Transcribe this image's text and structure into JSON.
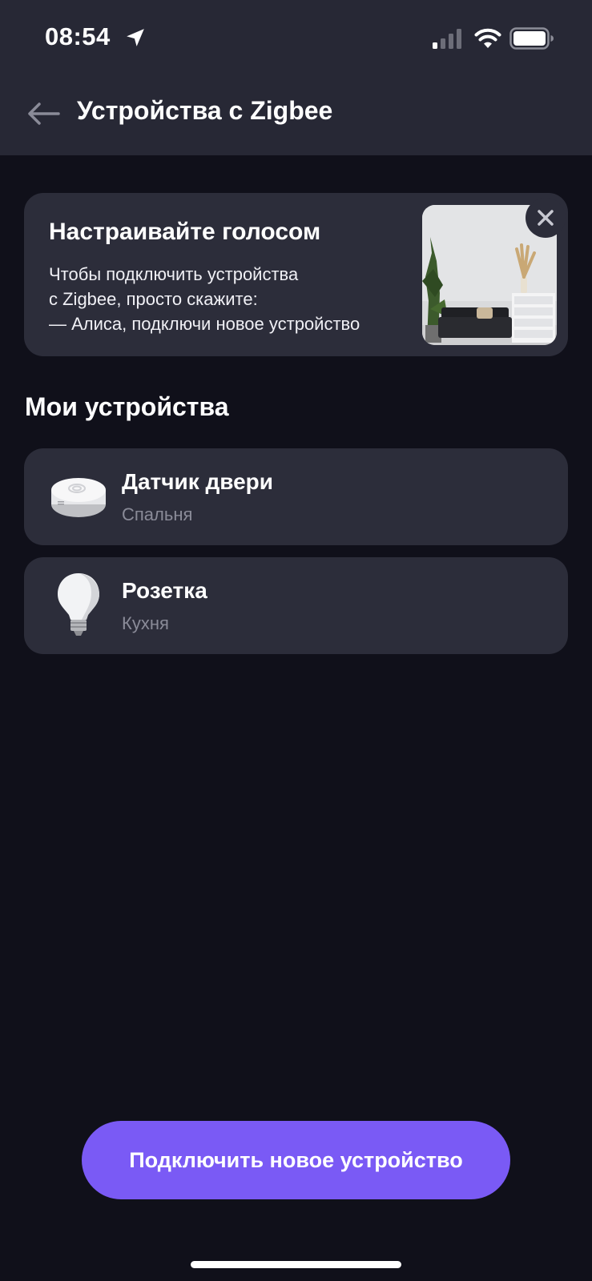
{
  "status_bar": {
    "time": "08:54",
    "icons": [
      "location-arrow-icon",
      "cellular-signal-icon",
      "wifi-icon",
      "battery-icon"
    ]
  },
  "header": {
    "title": "Устройства с Zigbee",
    "back_icon": "arrow-left-icon"
  },
  "promo": {
    "title": "Настраивайте голосом",
    "lines": [
      "Чтобы подключить устройства",
      "с Zigbee, просто скажите:",
      "— Алиса, подключи новое устройство"
    ],
    "close_icon": "close-icon"
  },
  "devices_section": {
    "title": "Мои устройства",
    "items": [
      {
        "name": "Датчик двери",
        "room": "Спальня",
        "icon": "door-sensor-icon"
      },
      {
        "name": "Розетка",
        "room": "Кухня",
        "icon": "light-bulb-icon"
      }
    ]
  },
  "actions": {
    "connect_label": "Подключить новое устройство"
  },
  "colors": {
    "background": "#10101a",
    "bars": "#272835",
    "card": "#2c2d3a",
    "accent": "#7a5af5",
    "secondary_text": "#8a8b98"
  }
}
